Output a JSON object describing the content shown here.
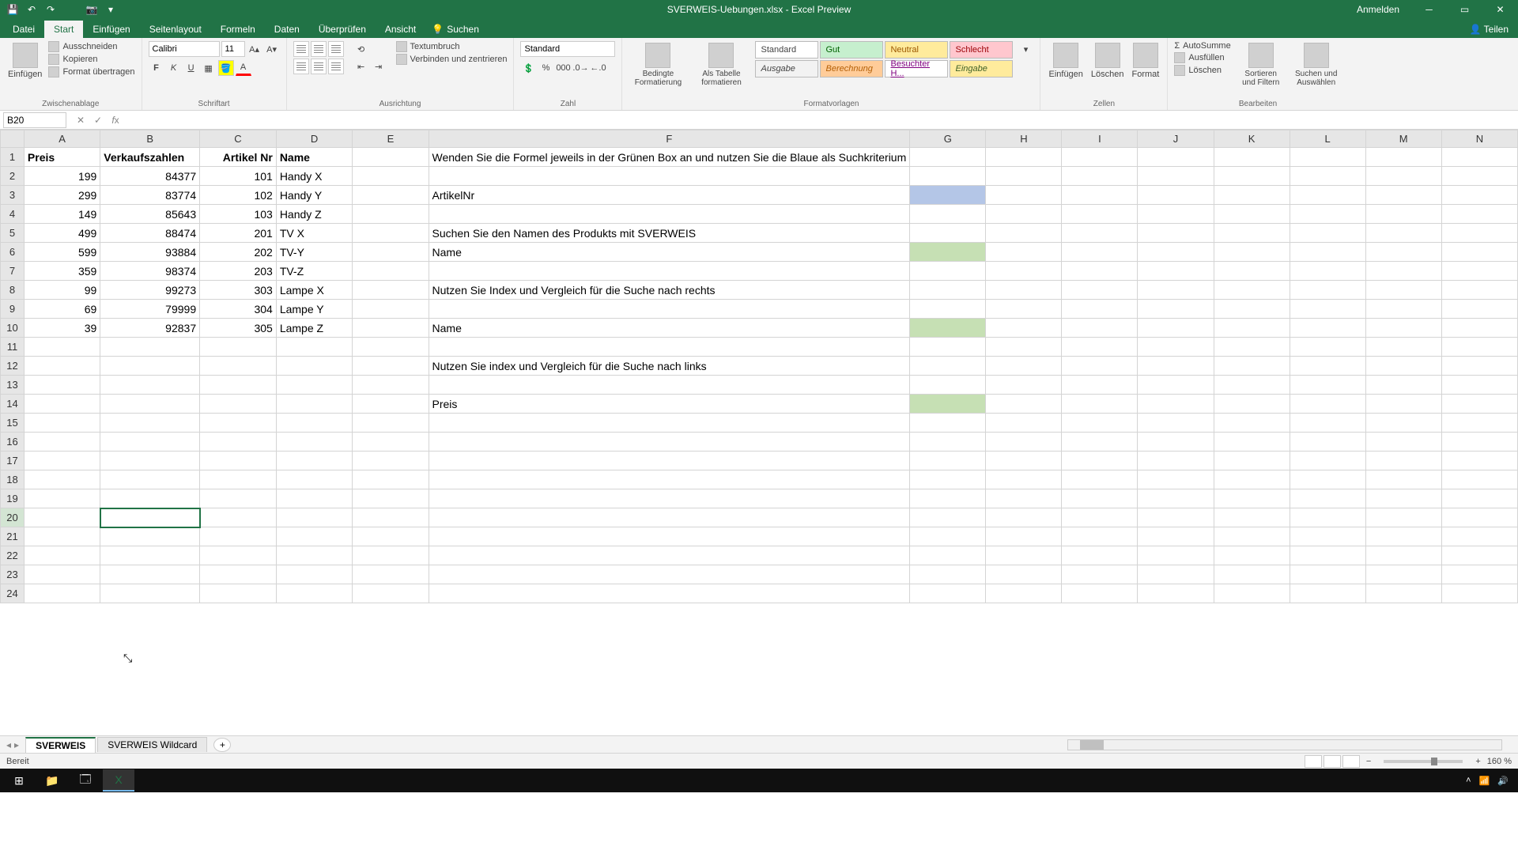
{
  "title": "SVERWEIS-Uebungen.xlsx - Excel Preview",
  "signin": "Anmelden",
  "qat": {
    "save": "💾",
    "undo": "↶",
    "redo": "↷",
    "camera": "📷",
    "touch": "▾"
  },
  "tabs": {
    "datei": "Datei",
    "start": "Start",
    "einfuegen": "Einfügen",
    "seitenlayout": "Seitenlayout",
    "formeln": "Formeln",
    "daten": "Daten",
    "ueberpruefen": "Überprüfen",
    "ansicht": "Ansicht",
    "suchen": "Suchen",
    "teilen": "Teilen"
  },
  "ribbon": {
    "clipboard": {
      "label": "Zwischenablage",
      "paste": "Einfügen",
      "cut": "Ausschneiden",
      "copy": "Kopieren",
      "format_painter": "Format übertragen"
    },
    "font": {
      "label": "Schriftart",
      "name": "Calibri",
      "size": "11"
    },
    "alignment": {
      "label": "Ausrichtung",
      "wrap": "Textumbruch",
      "merge": "Verbinden und zentrieren"
    },
    "number": {
      "label": "Zahl",
      "format": "Standard"
    },
    "styles": {
      "label": "Formatvorlagen",
      "cond_format": "Bedingte Formatierung",
      "as_table": "Als Tabelle formatieren",
      "standard": "Standard",
      "gut": "Gut",
      "neutral": "Neutral",
      "schlecht": "Schlecht",
      "ausgabe": "Ausgabe",
      "berechnung": "Berechnung",
      "besuchter": "Besuchter H...",
      "eingabe": "Eingabe"
    },
    "cells": {
      "label": "Zellen",
      "insert": "Einfügen",
      "delete": "Löschen",
      "format": "Format"
    },
    "editing": {
      "label": "Bearbeiten",
      "autosum": "AutoSumme",
      "fill": "Ausfüllen",
      "clear": "Löschen",
      "sort": "Sortieren und Filtern",
      "find": "Suchen und Auswählen"
    }
  },
  "name_box": "B20",
  "formula": "",
  "columns": [
    "A",
    "B",
    "C",
    "D",
    "E",
    "F",
    "G",
    "H",
    "I",
    "J",
    "K",
    "L",
    "M",
    "N"
  ],
  "headers": {
    "A": "Preis",
    "B": "Verkaufszahlen",
    "C": "Artikel Nr",
    "D": "Name"
  },
  "instruction": "Wenden Sie die Formel jeweils in der Grünen Box an und nutzen Sie die Blaue als Suchkriterium",
  "table": [
    {
      "preis": "199",
      "verkauf": "84377",
      "art": "101",
      "name": "Handy X"
    },
    {
      "preis": "299",
      "verkauf": "83774",
      "art": "102",
      "name": "Handy Y"
    },
    {
      "preis": "149",
      "verkauf": "85643",
      "art": "103",
      "name": "Handy Z"
    },
    {
      "preis": "499",
      "verkauf": "88474",
      "art": "201",
      "name": "TV X"
    },
    {
      "preis": "599",
      "verkauf": "93884",
      "art": "202",
      "name": "TV-Y"
    },
    {
      "preis": "359",
      "verkauf": "98374",
      "art": "203",
      "name": "TV-Z"
    },
    {
      "preis": "99",
      "verkauf": "99273",
      "art": "303",
      "name": "Lampe X"
    },
    {
      "preis": "69",
      "verkauf": "79999",
      "art": "304",
      "name": "Lampe Y"
    },
    {
      "preis": "39",
      "verkauf": "92837",
      "art": "305",
      "name": "Lampe Z"
    }
  ],
  "labels": {
    "artikelnr": "ArtikelNr",
    "task1": "Suchen Sie den Namen des Produkts mit SVERWEIS",
    "name1": "Name",
    "task2": "Nutzen Sie Index und Vergleich für die Suche nach rechts",
    "name2": "Name",
    "task3": "Nutzen Sie index und Vergleich für die Suche nach links",
    "preis": "Preis"
  },
  "sheets": {
    "s1": "SVERWEIS",
    "s2": "SVERWEIS Wildcard"
  },
  "status": {
    "ready": "Bereit",
    "zoom": "160 %"
  },
  "taskbar": {
    "time": ""
  }
}
